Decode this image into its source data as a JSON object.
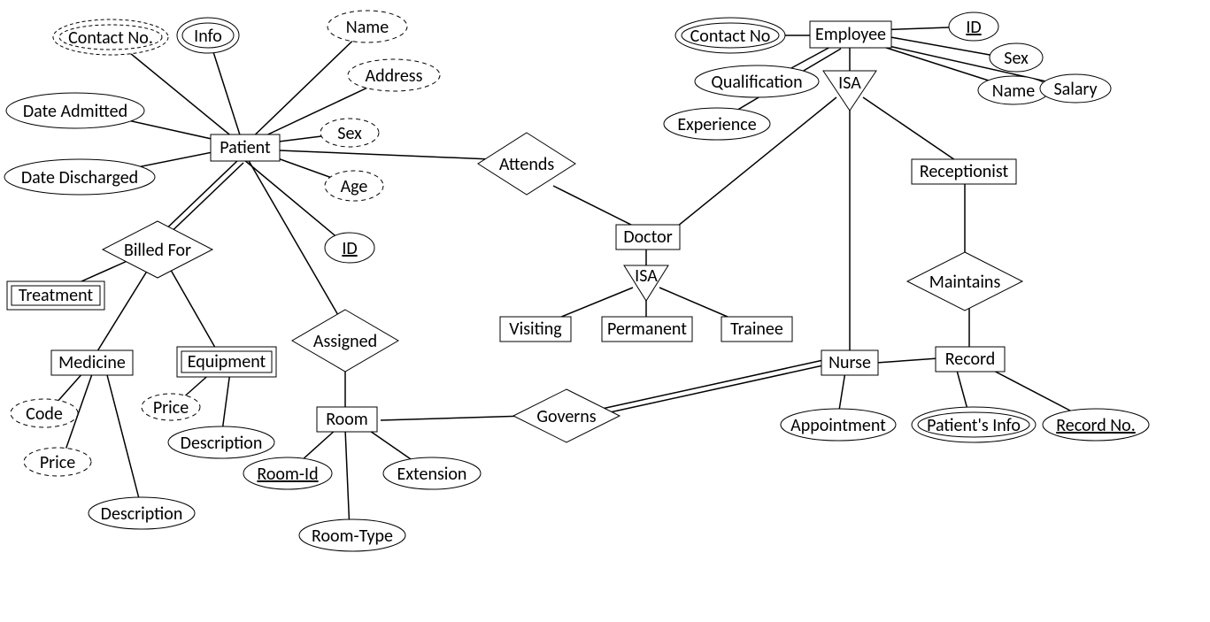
{
  "entities": {
    "patient": "Patient",
    "employee": "Employee",
    "doctor": "Doctor",
    "visiting": "Visiting",
    "permanent": "Permanent",
    "trainee": "Trainee",
    "nurse": "Nurse",
    "receptionist": "Receptionist",
    "record": "Record",
    "room": "Room",
    "medicine": "Medicine",
    "equipment": "Equipment",
    "treatment": "Treatment"
  },
  "relationships": {
    "attends": "Attends",
    "billed_for": "Billed For",
    "assigned": "Assigned",
    "governs": "Governs",
    "maintains": "Maintains",
    "isa1": "ISA",
    "isa2": "ISA"
  },
  "attrs": {
    "patient_contact_no": "Contact No.",
    "patient_info": "Info",
    "patient_name": "Name",
    "patient_address": "Address",
    "patient_date_admitted": "Date Admitted",
    "patient_date_discharged": "Date Discharged",
    "patient_sex": "Sex",
    "patient_age": "Age",
    "patient_id": "ID",
    "emp_contact_no": "Contact No",
    "emp_id": "ID",
    "emp_sex": "Sex",
    "emp_qualification": "Qualification",
    "emp_name": "Name",
    "emp_salary": "Salary",
    "emp_experience": "Experience",
    "med_code": "Code",
    "med_price": "Price",
    "med_desc": "Description",
    "eq_price": "Price",
    "eq_desc": "Description",
    "room_id": "Room-Id",
    "room_type": "Room-Type",
    "room_ext": "Extension",
    "nurse_appt": "Appointment",
    "rec_patient_info": "Patient's Info",
    "rec_no": "Record No."
  }
}
